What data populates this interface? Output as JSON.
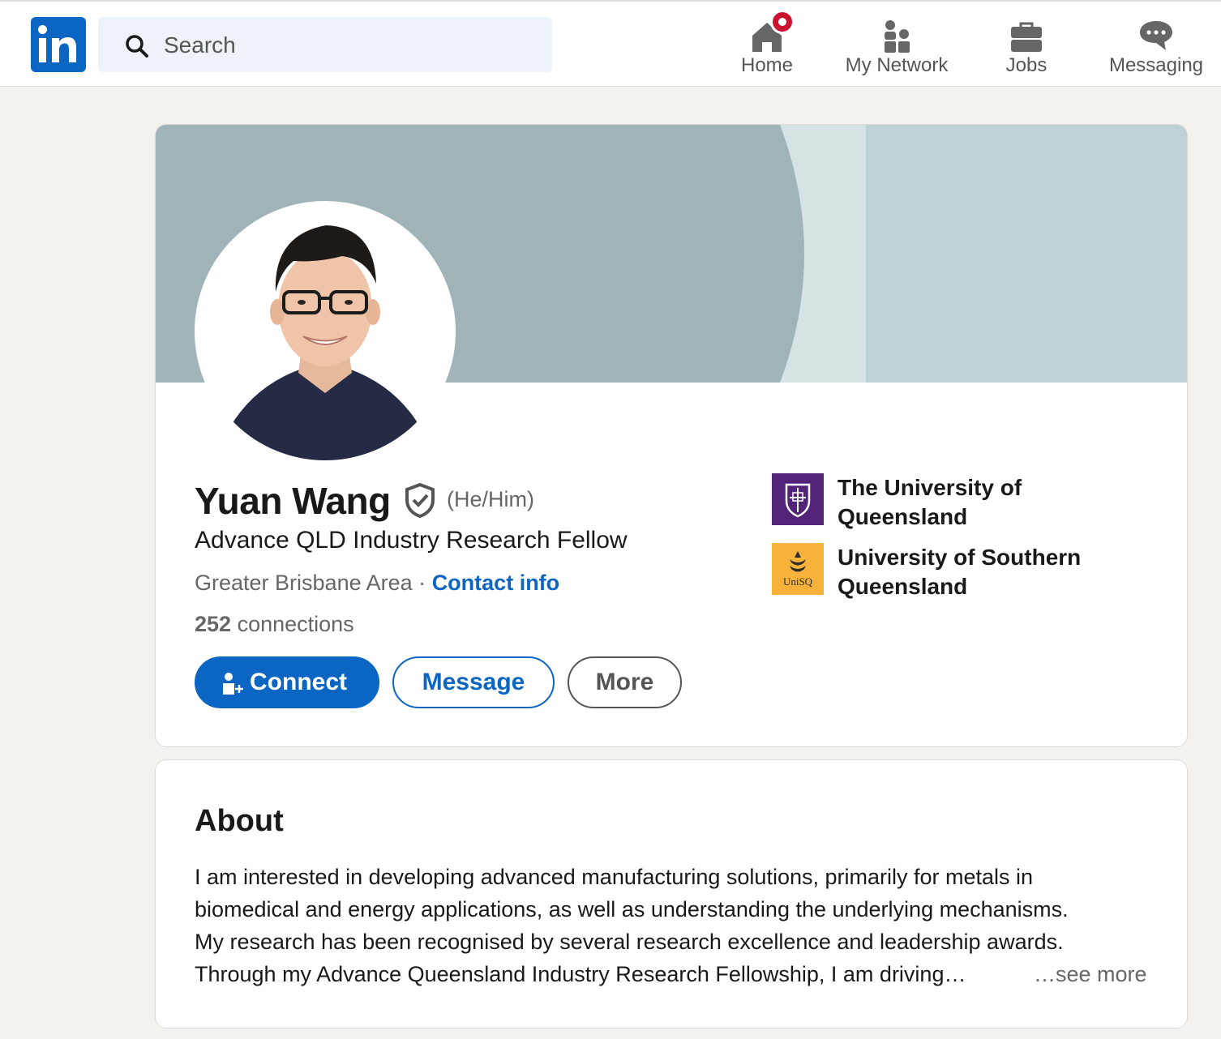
{
  "nav": {
    "search_placeholder": "Search",
    "items": [
      {
        "label": "Home",
        "icon": "home-icon"
      },
      {
        "label": "My Network",
        "icon": "network-icon"
      },
      {
        "label": "Jobs",
        "icon": "briefcase-icon"
      },
      {
        "label": "Messaging",
        "icon": "messaging-icon"
      }
    ]
  },
  "profile": {
    "name": "Yuan Wang",
    "pronouns": "(He/Him)",
    "headline": "Advance QLD Industry Research Fellow",
    "location": "Greater Brisbane Area",
    "separator": "·",
    "contact_info": "Contact info",
    "connections_count": "252",
    "connections_label": "connections",
    "buttons": {
      "connect": "Connect",
      "message": "Message",
      "more": "More"
    },
    "organizations": [
      {
        "name": "The University of Queensland",
        "logo": "uq-logo"
      },
      {
        "name": "University of Southern Queensland",
        "logo": "unisq-logo",
        "logo_text": "UniSQ"
      }
    ]
  },
  "about": {
    "title": "About",
    "lines": [
      "I am interested in developing advanced manufacturing solutions, primarily for metals in",
      "biomedical and energy applications, as well as understanding the underlying mechanisms.",
      "My research has been recognised by several research excellence and leadership awards.",
      "Through my Advance Queensland Industry Research Fellowship, I am driving…"
    ],
    "see_more": "…see more"
  },
  "colors": {
    "brand": "#0a66c2",
    "notification": "#cb112d",
    "uq_purple": "#51247a",
    "unisq_yellow": "#f7b23b"
  }
}
